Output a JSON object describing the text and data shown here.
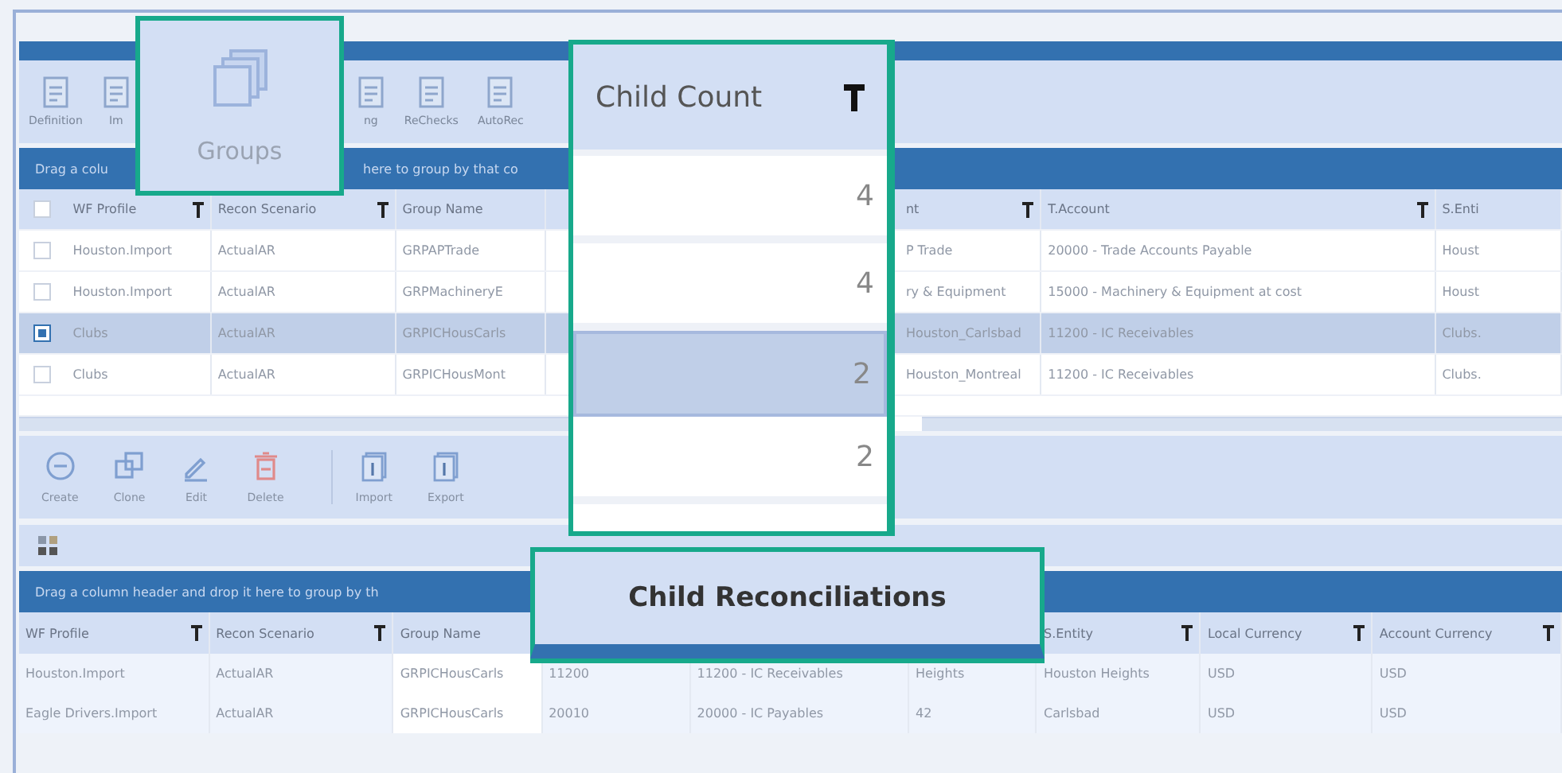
{
  "toolbar": [
    {
      "label": "Definition"
    },
    {
      "label": "Im"
    },
    {
      "label": "ng"
    },
    {
      "label": "ReChecks"
    },
    {
      "label": "AutoRec"
    }
  ],
  "groups_callout": {
    "label": "Groups"
  },
  "upper_group_bar": {
    "left": "Drag a colu",
    "right": "here to group by that co"
  },
  "upper_grid": {
    "all_checked": false,
    "left_columns": [
      {
        "label": "WF Profile",
        "filter": true
      },
      {
        "label": "Recon Scenario",
        "filter": true
      },
      {
        "label": "Group Name",
        "filter": false
      }
    ],
    "right_columns": [
      {
        "label": "nt",
        "filter": true
      },
      {
        "label": "T.Account",
        "filter": true
      },
      {
        "label": "S.Enti",
        "filter": false
      }
    ],
    "rows": [
      {
        "checked": false,
        "selected": false,
        "left": [
          "Houston.Import",
          "ActualAR",
          "GRPAPTrade"
        ],
        "right": [
          "P Trade",
          "20000 - Trade Accounts Payable",
          "Houst"
        ]
      },
      {
        "checked": false,
        "selected": false,
        "left": [
          "Houston.Import",
          "ActualAR",
          "GRPMachineryE"
        ],
        "right": [
          "ry & Equipment",
          "15000 - Machinery & Equipment at cost",
          "Houst"
        ]
      },
      {
        "checked": true,
        "selected": true,
        "left": [
          "Clubs",
          "ActualAR",
          "GRPICHousCarls"
        ],
        "right": [
          "Houston_Carlsbad",
          "11200 - IC Receivables",
          "Clubs."
        ]
      },
      {
        "checked": false,
        "selected": false,
        "left": [
          "Clubs",
          "ActualAR",
          "GRPICHousMont"
        ],
        "right": [
          "Houston_Montreal",
          "11200 - IC Receivables",
          "Clubs."
        ]
      }
    ]
  },
  "actions": [
    {
      "label": "Create",
      "kind": "create"
    },
    {
      "label": "Clone",
      "kind": "clone"
    },
    {
      "label": "Edit",
      "kind": "edit"
    },
    {
      "label": "Delete",
      "kind": "delete"
    },
    {
      "label": "Import",
      "kind": "import"
    },
    {
      "label": "Export",
      "kind": "import"
    }
  ],
  "child_count_callout": {
    "header": "Child Count",
    "filter": true,
    "cells": [
      {
        "value": "4",
        "selected": false
      },
      {
        "value": "4",
        "selected": false
      },
      {
        "value": "2",
        "selected": true
      },
      {
        "value": "2",
        "selected": false
      }
    ]
  },
  "lower_group_bar": {
    "text": "Drag a column header and drop it here to group by th"
  },
  "child_reconciliations_callout": {
    "title": "Child Reconciliations"
  },
  "lower_grid": {
    "columns": [
      {
        "label": "WF Profile",
        "filter": true
      },
      {
        "label": "Recon Scenario",
        "filter": true
      },
      {
        "label": "Group Name",
        "filter": false
      },
      {},
      {},
      {},
      {
        "label": "S.Entity",
        "filter": true
      },
      {
        "label": "Local Currency",
        "filter": true
      },
      {
        "label": "Account Currency",
        "filter": true
      }
    ],
    "rows": [
      [
        "Houston.Import",
        "ActualAR",
        "GRPICHousCarls",
        "11200",
        "11200 - IC Receivables",
        "Heights",
        "Houston Heights",
        "USD",
        "USD"
      ],
      [
        "Eagle Drivers.Import",
        "ActualAR",
        "GRPICHousCarls",
        "20010",
        "20000 - IC Payables",
        "42",
        "Carlsbad",
        "USD",
        "USD"
      ]
    ]
  }
}
